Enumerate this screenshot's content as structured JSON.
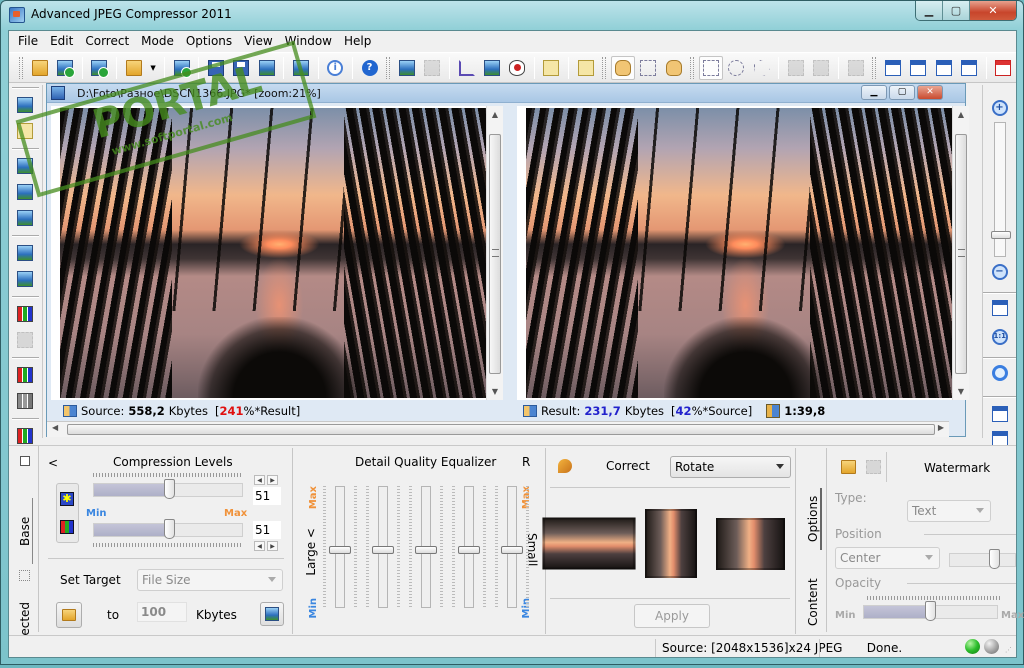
{
  "app": {
    "title": "Advanced JPEG Compressor 2011"
  },
  "menu": [
    "File",
    "Edit",
    "Correct",
    "Mode",
    "Options",
    "View",
    "Window",
    "Help"
  ],
  "toolbar": {
    "buttons": [
      "open-folder",
      "open-image-batch",
      "convert-run",
      "open-recent",
      "dropdown",
      "run-compress",
      "save",
      "save-as",
      "publish-web",
      "export-email",
      "info",
      "help",
      "duplicate-view",
      "paste-disabled",
      "crop",
      "resize",
      "preview-eye",
      "edit-watermark",
      "edit-properties",
      "hand-pan",
      "select-pointer",
      "grab-hand",
      "select-rectangle",
      "select-ellipse",
      "select-polygon",
      "delete-selection",
      "clear-selection",
      "copy-selection",
      "cascade-windows",
      "tile-horizontal",
      "tile-vertical",
      "tile-grid",
      "new-window"
    ]
  },
  "document": {
    "path": "D:\\Foto\\Разное\\DSCN1366.JPG* [zoom:21%]",
    "source_status": {
      "label": "Source:",
      "size": "558,2",
      "unit": "Kbytes",
      "pct_open": "[",
      "pct": "241",
      "pct_tail": "%*Result]"
    },
    "result_status": {
      "label": "Result:",
      "size": "231,7",
      "unit": "Kbytes",
      "pct_open": "[",
      "pct": "42",
      "pct_tail": "%*Source]",
      "ratio": "1:39,8"
    },
    "colors": {
      "source_pct": "#e01010",
      "result_accent": "#2222cc"
    }
  },
  "compression": {
    "title": "Compression Levels",
    "collapse": "<",
    "min_label": "Min",
    "max_label": "Max",
    "level1": 51,
    "level2": 51,
    "level1_display": "51",
    "level2_display": "51",
    "set_target_label": "Set Target",
    "target_type": "File Size",
    "to_label": "to",
    "target_value": "100",
    "target_unit": "Kbytes"
  },
  "side_tabs": {
    "base": "Base",
    "selected": "Selected"
  },
  "equalizer": {
    "title": "Detail Quality Equalizer",
    "reset": "R",
    "max_label": "Max",
    "min_label": "Min",
    "left_label": "Large",
    "left_arrow": "<",
    "right_label": "Small",
    "bands": [
      0.47,
      0.47,
      0.47,
      0.47,
      0.47
    ]
  },
  "correct": {
    "label": "Correct",
    "mode": "Rotate",
    "apply": "Apply"
  },
  "watermark": {
    "title": "Watermark",
    "type_label": "Type:",
    "type_value": "Text",
    "position_label": "Position",
    "position_value": "Center",
    "opacity_label": "Opacity",
    "min_label": "Min",
    "max_label": "Max",
    "opacity_value": 0.5,
    "tabs": {
      "options": "Options",
      "content": "Content"
    }
  },
  "statusbar": {
    "source_info": "Source: [2048x1536]x24 JPEG",
    "state": "Done."
  },
  "zoom": {
    "level_percent": 21,
    "slider_fraction": 0.15
  }
}
